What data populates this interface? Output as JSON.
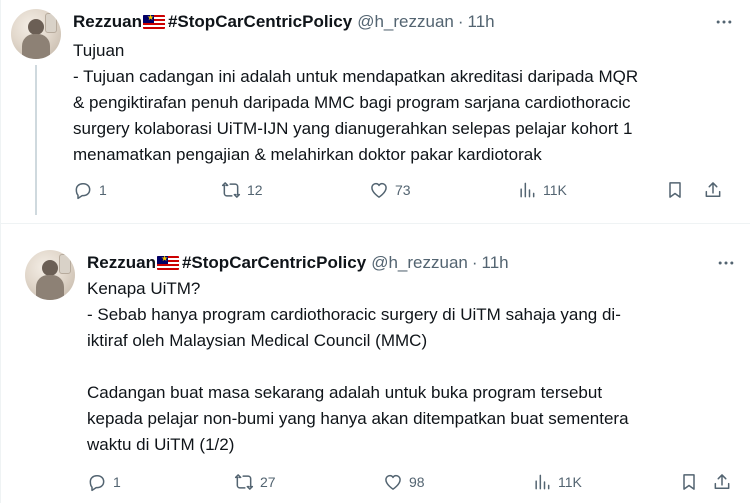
{
  "tweets": [
    {
      "display_name": "Rezzuan",
      "hashtag_name": "#StopCarCentricPolicy",
      "handle": "@h_rezzuan",
      "dot": "·",
      "time": "11h",
      "text": "Tujuan\n- Tujuan cadangan ini adalah untuk mendapatkan akreditasi daripada MQR\n& pengiktirafan penuh daripada MMC bagi program sarjana cardiothoracic\nsurgery kolaborasi UiTM-IJN yang dianugerahkan selepas pelajar kohort 1\nmenamatkan pengajian & melahirkan doktor pakar kardiotorak",
      "replies": "1",
      "reposts": "12",
      "likes": "73",
      "views": "11K"
    },
    {
      "display_name": "Rezzuan",
      "hashtag_name": "#StopCarCentricPolicy",
      "handle": "@h_rezzuan",
      "dot": "·",
      "time": "11h",
      "text": "Kenapa UiTM?\n- Sebab hanya program cardiothoracic surgery di UiTM sahaja yang di-\niktiraf oleh Malaysian Medical Council (MMC)\n\nCadangan buat masa sekarang adalah untuk buka program tersebut\nkepada pelajar non-bumi yang hanya akan ditempatkan buat sementera\nwaktu di UiTM (1/2)",
      "replies": "1",
      "reposts": "27",
      "likes": "98",
      "views": "11K"
    }
  ],
  "icons": {
    "flag": "malaysia-flag-icon",
    "more": "more-icon",
    "reply": "reply-icon",
    "repost": "repost-icon",
    "like": "heart-icon",
    "views": "analytics-icon",
    "bookmark": "bookmark-icon",
    "share": "share-icon"
  },
  "colors": {
    "text": "#0f1419",
    "secondary": "#536471",
    "border": "#eff3f4"
  }
}
